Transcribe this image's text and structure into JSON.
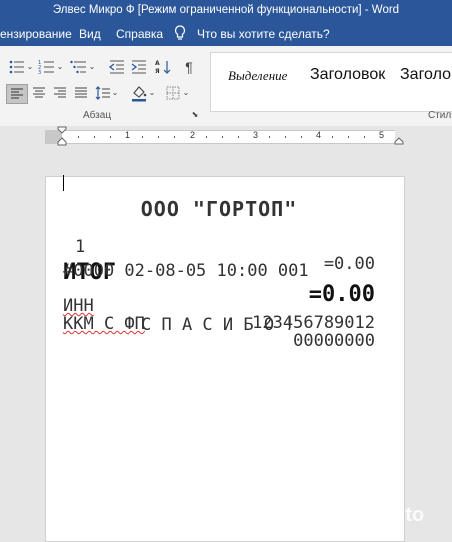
{
  "window": {
    "title": "Элвес Микро Ф [Режим ограниченной функциональности]  -  Word"
  },
  "menu": {
    "items": [
      "ензирование",
      "Вид",
      "Справка"
    ],
    "search": "Что вы хотите сделать?"
  },
  "ribbon": {
    "paragraph_label": "Абзац",
    "styles_label": "Стили",
    "styles": [
      "Выделение",
      "Заголовок",
      "Заголо"
    ]
  },
  "ruler": {
    "numbers": [
      "1",
      "2",
      "3",
      "4",
      "5"
    ]
  },
  "receipt": {
    "header": "ООО \"ГОРТОП\"",
    "line1_left": "1",
    "line1_right": "=0.00",
    "total_label": "ИТОГ",
    "total_value": "=0.00",
    "info_line": "#0000 02-08-05 10:00 001",
    "inn_label": "ИНН",
    "inn_value": "123456789012",
    "kkm_label": "ККМ С ФП",
    "kkm_value": "00000000",
    "thanks": "С П А С И Б О !"
  },
  "watermark": {
    "text": "Avito"
  }
}
